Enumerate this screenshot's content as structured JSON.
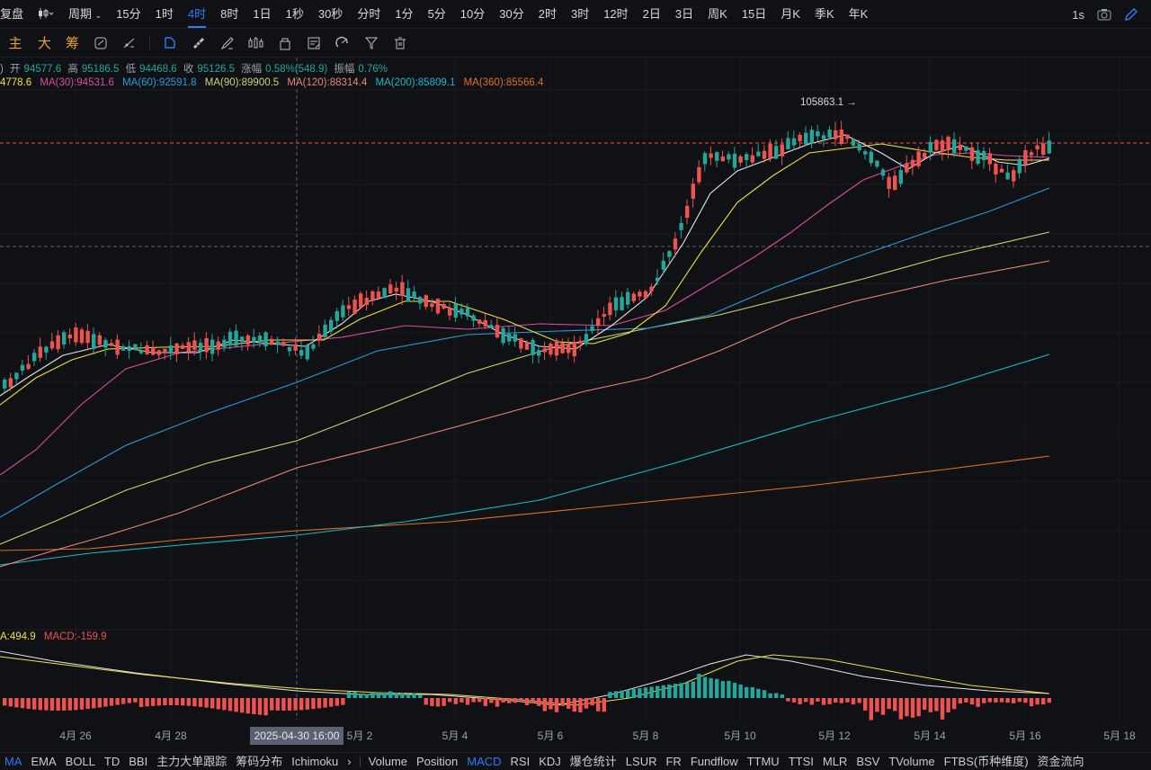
{
  "topbar": {
    "replay": "复盘",
    "chart_style_icon": "candlestick-icon",
    "period_label": "周期",
    "intervals": [
      "15分",
      "1时",
      "4时",
      "8时",
      "1日",
      "1秒",
      "30秒",
      "分时",
      "1分",
      "5分",
      "10分",
      "30分",
      "2时",
      "3时",
      "12时",
      "2日",
      "3日",
      "周K",
      "15日",
      "月K",
      "季K",
      "年K"
    ],
    "active_interval": "4时",
    "live_label": "1s"
  },
  "toolbar": {
    "modes": [
      "主",
      "大",
      "筹"
    ]
  },
  "ohlc_legend": {
    "open_label": "开",
    "open": "94577.6",
    "high_label": "高",
    "high": "95186.5",
    "low_label": "低",
    "low": "94468.6",
    "close_label": "收",
    "close": "95126.5",
    "change_label": "涨幅",
    "change": "0.58%(548.9)",
    "amplitude_label": "振幅",
    "amplitude": "0.76%"
  },
  "ma_legend": {
    "ma_partial": "4778.6",
    "ma30": "MA(30):94531.6",
    "ma60": "MA(60):92591.8",
    "ma90": "MA(90):89900.5",
    "ma120": "MA(120):88314.4",
    "ma200": "MA(200):85809.1",
    "ma360": "MA(360):85566.4"
  },
  "macd_legend": {
    "dea_partial": "A:494.9",
    "macd": "MACD:-159.9"
  },
  "colors": {
    "up": "#26a69a",
    "down": "#ef5350",
    "ma7": "#e6e6e6",
    "ma_partial": "#f0e04a",
    "ma30": "#d84ea5",
    "ma60": "#2d9ad8",
    "ma90": "#c7d873",
    "ma120": "#e8857c",
    "ma200": "#1fb8c9",
    "ma360": "#e0702a",
    "accent": "#2e7cf6"
  },
  "chart": {
    "high_marker": "105863.1 →",
    "crosshair_label": "2025-04-30 16:00",
    "x_labels": [
      "4月 26",
      "4月 28",
      "5月 2",
      "5月 4",
      "5月 6",
      "5月 8",
      "5月 10",
      "5月 12",
      "5月 14",
      "5月 16",
      "5月 18"
    ]
  },
  "chart_data": {
    "type": "candlestick",
    "interval": "4时",
    "high_annotation": 105863.1,
    "last": {
      "open": 94577.6,
      "high": 95186.5,
      "low": 94468.6,
      "close": 95126.5
    },
    "ma": {
      "MA30": 94531.6,
      "MA60": 92591.8,
      "MA90": 89900.5,
      "MA120": 88314.4,
      "MA200": 85809.1,
      "MA360": 85566.4
    },
    "macd": {
      "MACD": -159.9
    }
  },
  "bottombar": {
    "indicators": [
      "MA",
      "EMA",
      "BOLL",
      "TD",
      "BBI",
      "主力大单跟踪",
      "筹码分布",
      "Ichimoku"
    ],
    "more_symbol": "›",
    "sub_indicators": [
      "Volume",
      "Position",
      "MACD",
      "RSI",
      "KDJ",
      "爆仓统计",
      "LSUR",
      "FR",
      "Fundflow",
      "TTMU",
      "TTSI",
      "MLR",
      "BSV",
      "TVolume",
      "FTBS(币种维度)",
      "资金流向"
    ],
    "active_main": "MA",
    "active_sub": "MACD"
  }
}
